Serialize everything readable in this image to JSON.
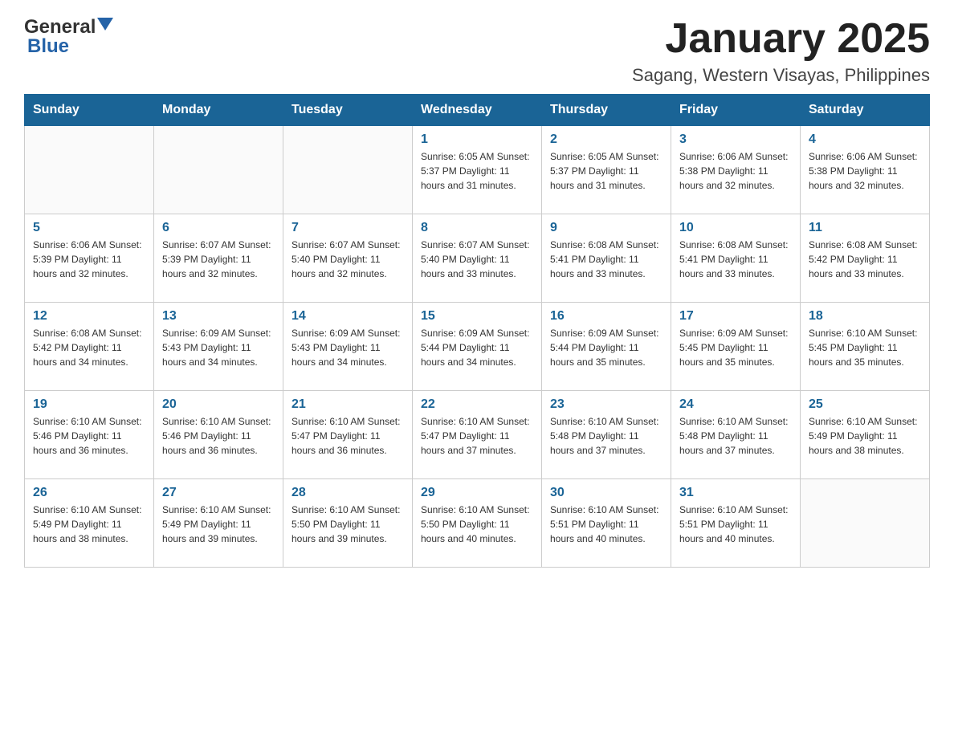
{
  "header": {
    "logo_general": "General",
    "logo_blue": "Blue",
    "month_title": "January 2025",
    "location": "Sagang, Western Visayas, Philippines"
  },
  "weekdays": [
    "Sunday",
    "Monday",
    "Tuesday",
    "Wednesday",
    "Thursday",
    "Friday",
    "Saturday"
  ],
  "weeks": [
    [
      {
        "day": "",
        "info": ""
      },
      {
        "day": "",
        "info": ""
      },
      {
        "day": "",
        "info": ""
      },
      {
        "day": "1",
        "info": "Sunrise: 6:05 AM\nSunset: 5:37 PM\nDaylight: 11 hours and 31 minutes."
      },
      {
        "day": "2",
        "info": "Sunrise: 6:05 AM\nSunset: 5:37 PM\nDaylight: 11 hours and 31 minutes."
      },
      {
        "day": "3",
        "info": "Sunrise: 6:06 AM\nSunset: 5:38 PM\nDaylight: 11 hours and 32 minutes."
      },
      {
        "day": "4",
        "info": "Sunrise: 6:06 AM\nSunset: 5:38 PM\nDaylight: 11 hours and 32 minutes."
      }
    ],
    [
      {
        "day": "5",
        "info": "Sunrise: 6:06 AM\nSunset: 5:39 PM\nDaylight: 11 hours and 32 minutes."
      },
      {
        "day": "6",
        "info": "Sunrise: 6:07 AM\nSunset: 5:39 PM\nDaylight: 11 hours and 32 minutes."
      },
      {
        "day": "7",
        "info": "Sunrise: 6:07 AM\nSunset: 5:40 PM\nDaylight: 11 hours and 32 minutes."
      },
      {
        "day": "8",
        "info": "Sunrise: 6:07 AM\nSunset: 5:40 PM\nDaylight: 11 hours and 33 minutes."
      },
      {
        "day": "9",
        "info": "Sunrise: 6:08 AM\nSunset: 5:41 PM\nDaylight: 11 hours and 33 minutes."
      },
      {
        "day": "10",
        "info": "Sunrise: 6:08 AM\nSunset: 5:41 PM\nDaylight: 11 hours and 33 minutes."
      },
      {
        "day": "11",
        "info": "Sunrise: 6:08 AM\nSunset: 5:42 PM\nDaylight: 11 hours and 33 minutes."
      }
    ],
    [
      {
        "day": "12",
        "info": "Sunrise: 6:08 AM\nSunset: 5:42 PM\nDaylight: 11 hours and 34 minutes."
      },
      {
        "day": "13",
        "info": "Sunrise: 6:09 AM\nSunset: 5:43 PM\nDaylight: 11 hours and 34 minutes."
      },
      {
        "day": "14",
        "info": "Sunrise: 6:09 AM\nSunset: 5:43 PM\nDaylight: 11 hours and 34 minutes."
      },
      {
        "day": "15",
        "info": "Sunrise: 6:09 AM\nSunset: 5:44 PM\nDaylight: 11 hours and 34 minutes."
      },
      {
        "day": "16",
        "info": "Sunrise: 6:09 AM\nSunset: 5:44 PM\nDaylight: 11 hours and 35 minutes."
      },
      {
        "day": "17",
        "info": "Sunrise: 6:09 AM\nSunset: 5:45 PM\nDaylight: 11 hours and 35 minutes."
      },
      {
        "day": "18",
        "info": "Sunrise: 6:10 AM\nSunset: 5:45 PM\nDaylight: 11 hours and 35 minutes."
      }
    ],
    [
      {
        "day": "19",
        "info": "Sunrise: 6:10 AM\nSunset: 5:46 PM\nDaylight: 11 hours and 36 minutes."
      },
      {
        "day": "20",
        "info": "Sunrise: 6:10 AM\nSunset: 5:46 PM\nDaylight: 11 hours and 36 minutes."
      },
      {
        "day": "21",
        "info": "Sunrise: 6:10 AM\nSunset: 5:47 PM\nDaylight: 11 hours and 36 minutes."
      },
      {
        "day": "22",
        "info": "Sunrise: 6:10 AM\nSunset: 5:47 PM\nDaylight: 11 hours and 37 minutes."
      },
      {
        "day": "23",
        "info": "Sunrise: 6:10 AM\nSunset: 5:48 PM\nDaylight: 11 hours and 37 minutes."
      },
      {
        "day": "24",
        "info": "Sunrise: 6:10 AM\nSunset: 5:48 PM\nDaylight: 11 hours and 37 minutes."
      },
      {
        "day": "25",
        "info": "Sunrise: 6:10 AM\nSunset: 5:49 PM\nDaylight: 11 hours and 38 minutes."
      }
    ],
    [
      {
        "day": "26",
        "info": "Sunrise: 6:10 AM\nSunset: 5:49 PM\nDaylight: 11 hours and 38 minutes."
      },
      {
        "day": "27",
        "info": "Sunrise: 6:10 AM\nSunset: 5:49 PM\nDaylight: 11 hours and 39 minutes."
      },
      {
        "day": "28",
        "info": "Sunrise: 6:10 AM\nSunset: 5:50 PM\nDaylight: 11 hours and 39 minutes."
      },
      {
        "day": "29",
        "info": "Sunrise: 6:10 AM\nSunset: 5:50 PM\nDaylight: 11 hours and 40 minutes."
      },
      {
        "day": "30",
        "info": "Sunrise: 6:10 AM\nSunset: 5:51 PM\nDaylight: 11 hours and 40 minutes."
      },
      {
        "day": "31",
        "info": "Sunrise: 6:10 AM\nSunset: 5:51 PM\nDaylight: 11 hours and 40 minutes."
      },
      {
        "day": "",
        "info": ""
      }
    ]
  ]
}
